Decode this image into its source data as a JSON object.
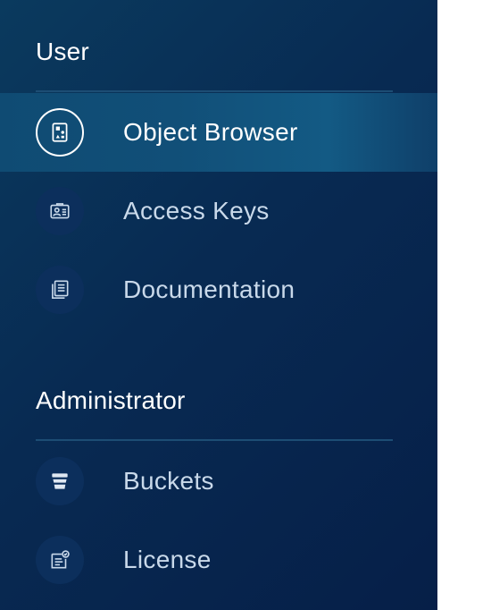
{
  "colors": {
    "sidebar_bg_start": "#0a3a5e",
    "sidebar_bg_end": "#061f48",
    "active_item_bg": "#135a84",
    "icon_bg": "#0c2f5c",
    "label_text": "#c9d9ea",
    "active_text": "#ffffff"
  },
  "sections": [
    {
      "title": "User",
      "items": [
        {
          "label": "Object Browser",
          "icon": "object-browser-icon",
          "active": true
        },
        {
          "label": "Access Keys",
          "icon": "access-keys-icon",
          "active": false
        },
        {
          "label": "Documentation",
          "icon": "documentation-icon",
          "active": false
        }
      ]
    },
    {
      "title": "Administrator",
      "items": [
        {
          "label": "Buckets",
          "icon": "buckets-icon",
          "active": false
        },
        {
          "label": "License",
          "icon": "license-icon",
          "active": false
        }
      ]
    }
  ]
}
